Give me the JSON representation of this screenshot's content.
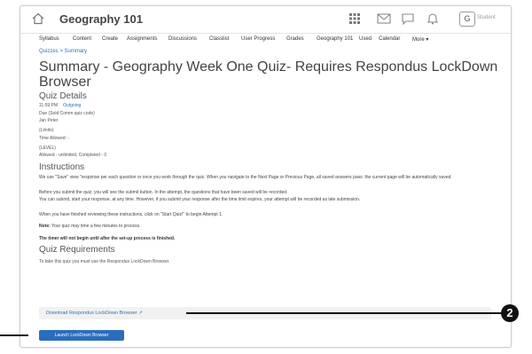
{
  "header": {
    "course_title": "Geography 101",
    "user_initial": "G",
    "user_name": "Student"
  },
  "nav": {
    "items": [
      "Syllabus",
      "Content",
      "Create",
      "Assignments",
      "Discussions",
      "Classlist",
      "User Progress",
      "Grades",
      "Geography 101",
      "Used",
      "Calendar",
      "More"
    ]
  },
  "breadcrumb": "Quizzes > Summary",
  "page": {
    "title": "Summary - Geography Week One Quiz- Requires Respondus LockDown Browser"
  },
  "quiz_details": {
    "heading": "Quiz Details",
    "time_line": "11:59 PM",
    "time_link": "Outgoing",
    "line1": "Due (Sold Comm quiz code)",
    "line2": "Jan Peter",
    "line3": "(Limits)",
    "line4": "Time Allowed: -",
    "line5": "(LEVEL)",
    "line6": "Allowed - unlimited, Completed - 0"
  },
  "instructions": {
    "heading": "Instructions",
    "p1": "We use \"Save\" view \"response per each question or once you work through the quiz. When you navigate to the Next Page or Previous Page, all saved answers pass. the current page will be automatically saved.",
    "p2": "Before you submit the quiz, you will see the submit button. In the attempt, the questions that have been saved will be recorded.",
    "p3": "You can submit, start your response, at any time. However, if you submit your response after the time limit expires, your attempt will be recorded as late submission.",
    "p4": "When you have finished reviewing these instructions, click on \"Start Quiz!\" to begin Attempt 1.",
    "note_label": "Note:",
    "note_text": "Your quiz may time a few minutes to process.",
    "bold_line": "The timer will not begin until after the set-up process is finished."
  },
  "quiz_requirements": {
    "heading": "Quiz Requirements",
    "text": "To take this quiz you must use the Respondus LockDown Browser.",
    "download_link": "Download Respondus LockDown Browser",
    "launch_button": "Launch LockDown Browser"
  },
  "callout": {
    "number": "2"
  }
}
